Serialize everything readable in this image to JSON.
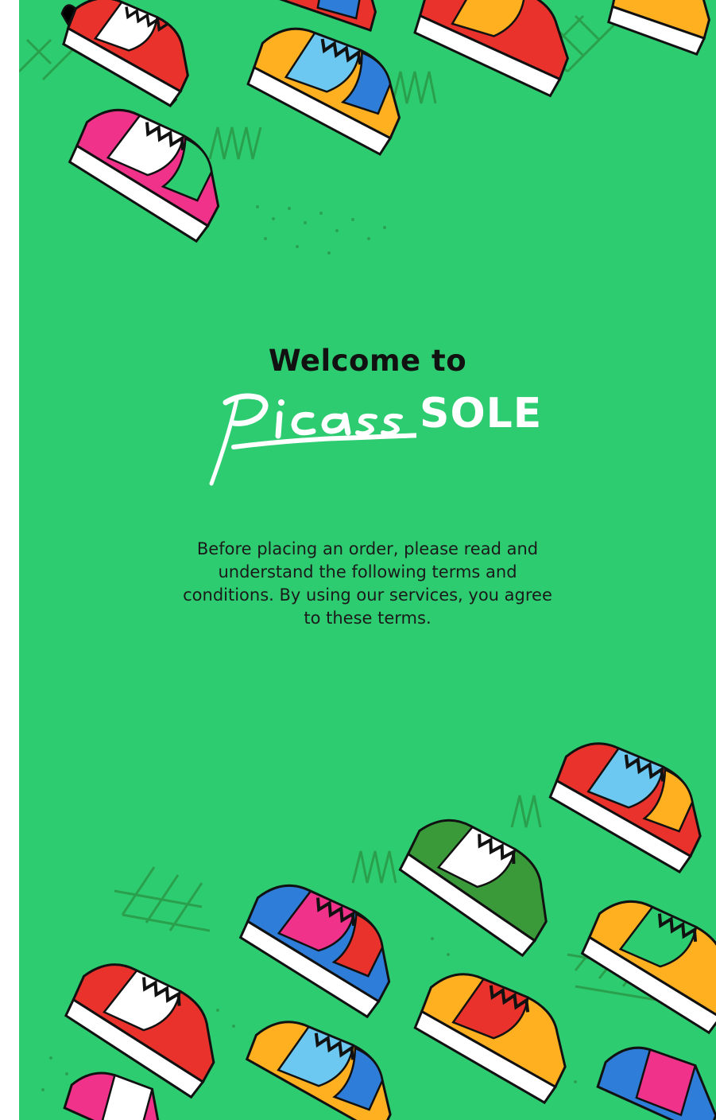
{
  "colors": {
    "background": "#2ECC71",
    "text": "#111111",
    "logo": "#FFFFFF",
    "scribble": "#2A9A48"
  },
  "welcome": {
    "text": "Welcome to"
  },
  "brand": {
    "script_part": "Picas",
    "block_part": "SOLE"
  },
  "terms": {
    "text": "Before placing an order, please read and understand the following terms and conditions. By using our services, you agree to these terms."
  },
  "decorations": {
    "top_group": "sneaker-illustrations",
    "bottom_group": "sneaker-illustrations"
  }
}
